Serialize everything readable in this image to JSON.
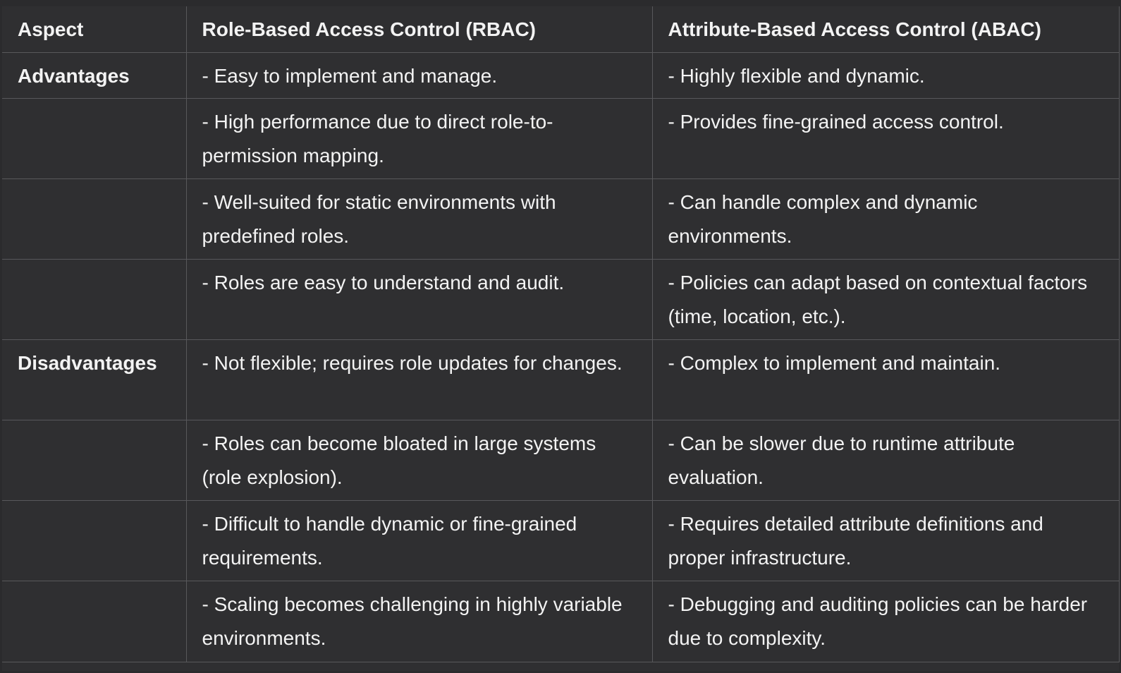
{
  "headers": [
    "Aspect",
    "Role-Based Access Control (RBAC)",
    "Attribute-Based Access Control (ABAC)"
  ],
  "rows": [
    {
      "aspect": "Advantages",
      "rbac": "- Easy to implement and manage.",
      "abac": "- Highly flexible and dynamic."
    },
    {
      "aspect": "",
      "rbac": "- High performance due to direct role-to-permission mapping.",
      "abac": "- Provides fine-grained access control."
    },
    {
      "aspect": "",
      "rbac": "- Well-suited for static environments with predefined roles.",
      "abac": "- Can handle complex and dynamic environments."
    },
    {
      "aspect": "",
      "rbac": "- Roles are easy to understand and audit.",
      "abac": "- Policies can adapt based on contextual factors (time, location, etc.)."
    },
    {
      "aspect": "Disadvantages",
      "rbac": "- Not flexible; requires role updates for changes.",
      "abac": "- Complex to implement and maintain."
    },
    {
      "aspect": "",
      "rbac": "- Roles can become bloated in large systems (role explosion).",
      "abac": "- Can be slower due to runtime attribute evaluation."
    },
    {
      "aspect": "",
      "rbac": "- Difficult to handle dynamic or fine-grained requirements.",
      "abac": "- Requires detailed attribute definitions and proper infrastructure."
    },
    {
      "aspect": "",
      "rbac": "- Scaling becomes challenging in highly variable environments.",
      "abac": "- Debugging and auditing policies can be harder due to complexity."
    }
  ]
}
